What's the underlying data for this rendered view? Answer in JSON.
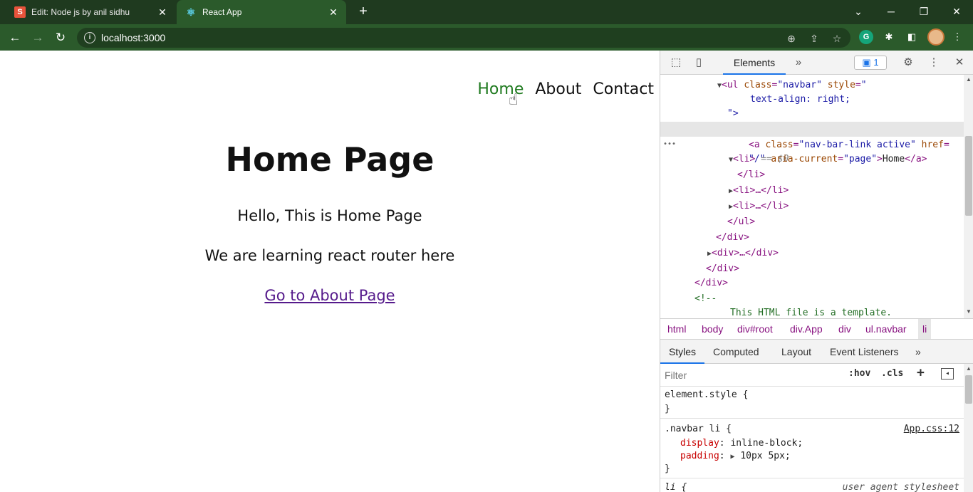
{
  "browser": {
    "tabs": [
      {
        "favicon": "S",
        "title": "Edit: Node js by anil sidhu"
      },
      {
        "favicon": "⚛",
        "title": "React App"
      }
    ],
    "new_tab": "+",
    "window_controls": {
      "chevron": "⌄",
      "minimize": "─",
      "restore": "❐",
      "close": "✕"
    },
    "back": "←",
    "forward": "→",
    "reload": "↻",
    "info_icon": "i",
    "url": "localhost:3000",
    "omni_icons": {
      "zoom": "⊕",
      "share": "⇪",
      "star": "☆"
    },
    "extensions": {
      "grammarly": "G",
      "puzzle": "✱",
      "sidepanel": "◧",
      "menu": "⋮"
    }
  },
  "page": {
    "nav": [
      "Home",
      "About",
      "Contact"
    ],
    "cursor": "☝",
    "heading": "Home Page",
    "para1": "Hello, This is Home Page",
    "para2": "We are learning react router here",
    "link": "Go to About Page"
  },
  "devtools": {
    "top": {
      "inspect": "⬚",
      "device": "▯",
      "elements_tab": "Elements",
      "more": "»",
      "issues_badge": "1",
      "settings": "⚙",
      "menu": "⋮",
      "close": "✕"
    },
    "dom": {
      "l1_tag": "<ul ",
      "l1_attr1": "class",
      "l1_val1": "\"navbar\"",
      "l1_attr2": "style",
      "l1_val2": "\"",
      "l2": "text-align: right;",
      "l3": "\">",
      "l4_ellipsis": "•••",
      "l4_tag": "<li>",
      "l4_marker": " == $0",
      "l5_tag": "<a ",
      "l5_attr1": "class",
      "l5_val1": "\"nav-bar-link active\"",
      "l5_attr2": "href",
      "l6_val1": "\"/\"",
      "l6_attr": "aria-current",
      "l6_val2": "\"page\"",
      "l6_text": "Home",
      "l6_close": "</a>",
      "l7": "</li>",
      "l8": "<li>…</li>",
      "l9": "<li>…</li>",
      "l10": "</ul>",
      "l11": "</div>",
      "l12": "<div>…</div>",
      "l13": "</div>",
      "l14": "</div>",
      "l15": "<!--",
      "l16": "This HTML file is a template."
    },
    "breadcrumbs": [
      "html",
      "body",
      "div#root",
      "div.App",
      "div",
      "ul.navbar",
      "li"
    ],
    "sub_tabs": [
      "Styles",
      "Computed",
      "Layout",
      "Event Listeners",
      "»"
    ],
    "filter_placeholder": "Filter",
    "filter_buttons": {
      "hov": ":hov",
      "cls": ".cls",
      "plus": "+",
      "toggle": "◂"
    },
    "styles": {
      "r1_selector": "element.style {",
      "r1_close": "}",
      "r2_selector": ".navbar li {",
      "r2_source": "App.css:12",
      "r2_p1_name": "display",
      "r2_p1_val": "inline-block;",
      "r2_p2_name": "padding",
      "r2_p2_val": "10px 5px;",
      "r2_close": "}",
      "r3_selector": "li {",
      "r3_source": "user agent stylesheet"
    }
  }
}
